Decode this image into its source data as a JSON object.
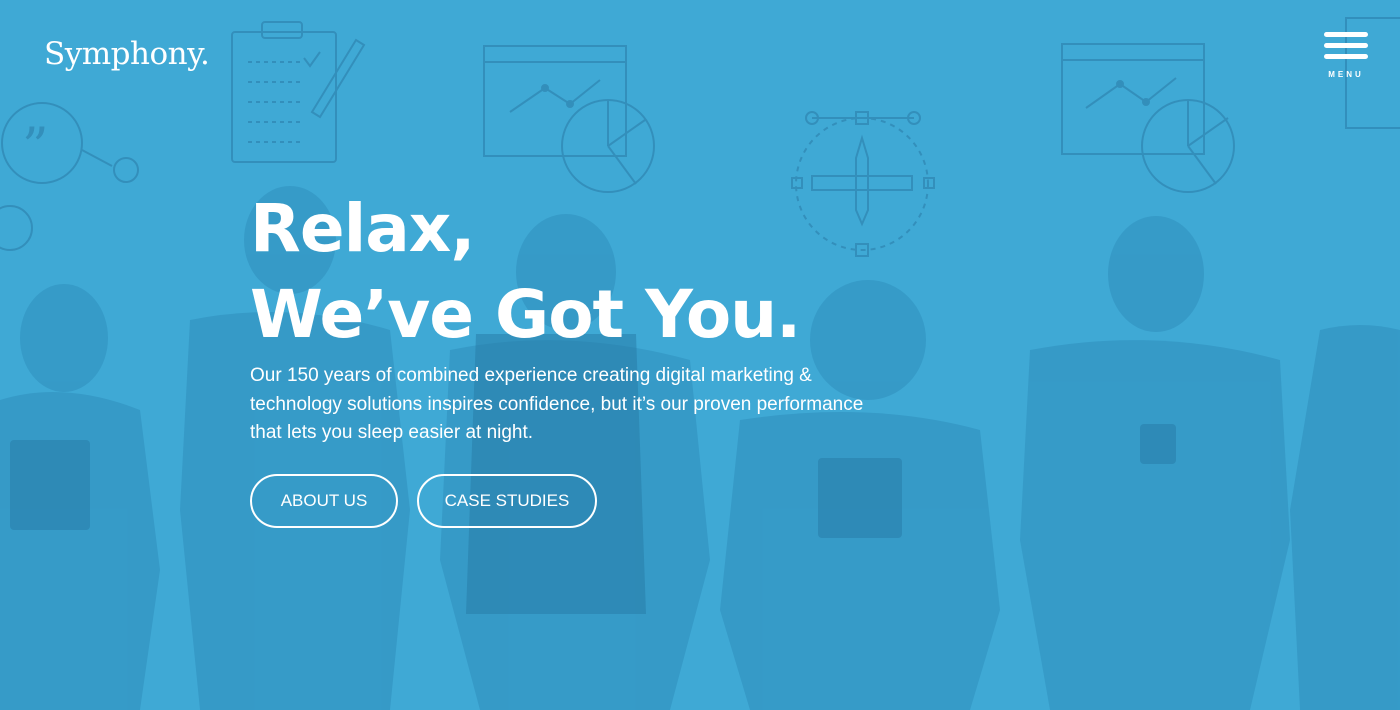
{
  "brand": {
    "logo_text": "Symphony."
  },
  "nav": {
    "menu_label": "MENU",
    "menu_icon": "hamburger-icon"
  },
  "hero": {
    "headline_line1": "Relax,",
    "headline_line2": "We’ve Got You.",
    "tagline": "Our 150 years of combined experience creating digital marketing & technology solutions inspires confidence, but it’s our proven performance that lets you sleep easier at night.",
    "buttons": {
      "about_label": "ABOUT US",
      "cases_label": "CASE STUDIES"
    },
    "background_icons": [
      "clipboard-icon",
      "quote-bubble-icon",
      "line-chart-window-icon",
      "pie-chart-icon",
      "pen-tool-icon",
      "people-with-devices-photo"
    ]
  },
  "colors": {
    "overlay": "#3fa9d5",
    "text": "#ffffff",
    "art_dark": "#2f87b3"
  }
}
